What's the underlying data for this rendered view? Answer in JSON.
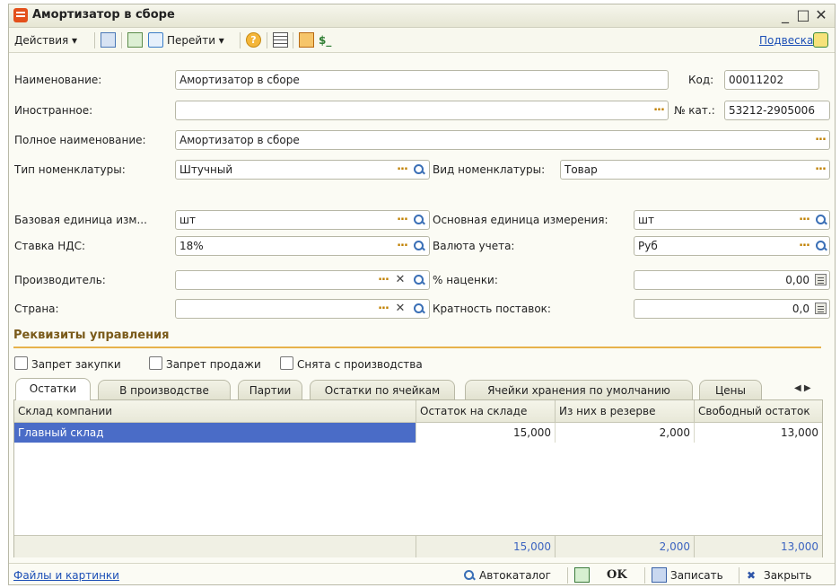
{
  "window": {
    "title": "Амортизатор в сборе",
    "minimize": "_",
    "maximize": "□",
    "close": "✕"
  },
  "toolbar": {
    "actions_label": "Действия ▾",
    "goto_label": "Перейти ▾",
    "currency_glyph": "$_",
    "podveska_link": "Подвеска"
  },
  "form": {
    "name_label": "Наименование:",
    "name_value": "Амортизатор в сборе",
    "code_label": "Код:",
    "code_value": "00011202",
    "foreign_label": "Иностранное:",
    "foreign_value": "",
    "catno_label": "№ кат.:",
    "catno_value": "53212-2905006",
    "fullname_label": "Полное наименование:",
    "fullname_value": "Амортизатор в сборе",
    "type_label": "Тип номенклатуры:",
    "type_value": "Штучный",
    "kind_label": "Вид номенклатуры:",
    "kind_value": "Товар",
    "base_unit_label": "Базовая единица изм...",
    "base_unit_value": "шт",
    "main_unit_label": "Основная единица измерения:",
    "main_unit_value": "шт",
    "vat_label": "Ставка НДС:",
    "vat_value": "18%",
    "currency_label": "Валюта учета:",
    "currency_value": "Руб",
    "producer_label": "Производитель:",
    "producer_value": "",
    "markup_label": "% наценки:",
    "markup_value": "0,00",
    "country_label": "Страна:",
    "country_value": "",
    "multiplicity_label": "Кратность поставок:",
    "multiplicity_value": "0,0"
  },
  "section": {
    "title": "Реквизиты управления"
  },
  "checkboxes": [
    {
      "label": "Запрет закупки"
    },
    {
      "label": "Запрет продажи"
    },
    {
      "label": "Снята с производства"
    }
  ],
  "tabs": [
    {
      "label": "Остатки"
    },
    {
      "label": "В производстве"
    },
    {
      "label": "Партии"
    },
    {
      "label": "Остатки по ячейкам"
    },
    {
      "label": "Ячейки хранения по умолчанию"
    },
    {
      "label": "Цены"
    }
  ],
  "tab_scroll": "◀ ▶",
  "grid": {
    "columns": [
      "Склад компании",
      "Остаток на складе",
      "Из них в резерве",
      "Свободный остаток"
    ],
    "rows": [
      [
        "Главный склад",
        "15,000",
        "2,000",
        "13,000"
      ]
    ],
    "totals": [
      "15,000",
      "2,000",
      "13,000"
    ]
  },
  "bottom": {
    "files_link": "Файлы и картинки",
    "autocatalog": "Автокаталог",
    "ok": "OK",
    "save": "Записать",
    "close": "Закрыть"
  }
}
